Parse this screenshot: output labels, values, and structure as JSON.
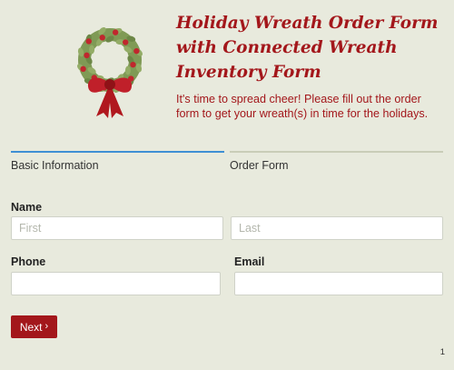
{
  "header": {
    "title": "Holiday Wreath Order Form with Connected Wreath Inventory Form",
    "subtitle": "It's time to spread cheer! Please fill out the order form to get your wreath(s) in time for the holidays.",
    "logo_icon": "wreath-icon"
  },
  "tabs": [
    {
      "label": "Basic Information",
      "active": true
    },
    {
      "label": "Order Form",
      "active": false
    }
  ],
  "form": {
    "name": {
      "label": "Name",
      "first_placeholder": "First",
      "last_placeholder": "Last",
      "first_value": "",
      "last_value": ""
    },
    "phone": {
      "label": "Phone",
      "value": ""
    },
    "email": {
      "label": "Email",
      "value": ""
    }
  },
  "next_button": {
    "label": "Next",
    "icon": "chevron-right-icon"
  },
  "page_number": "1",
  "colors": {
    "background": "#e8eadd",
    "brand_red": "#a3171b",
    "active_tab": "#3f8fd4",
    "inactive_tab": "#c9cdb8",
    "wreath_green": "#7f9a55",
    "berry_red": "#c0272d"
  }
}
